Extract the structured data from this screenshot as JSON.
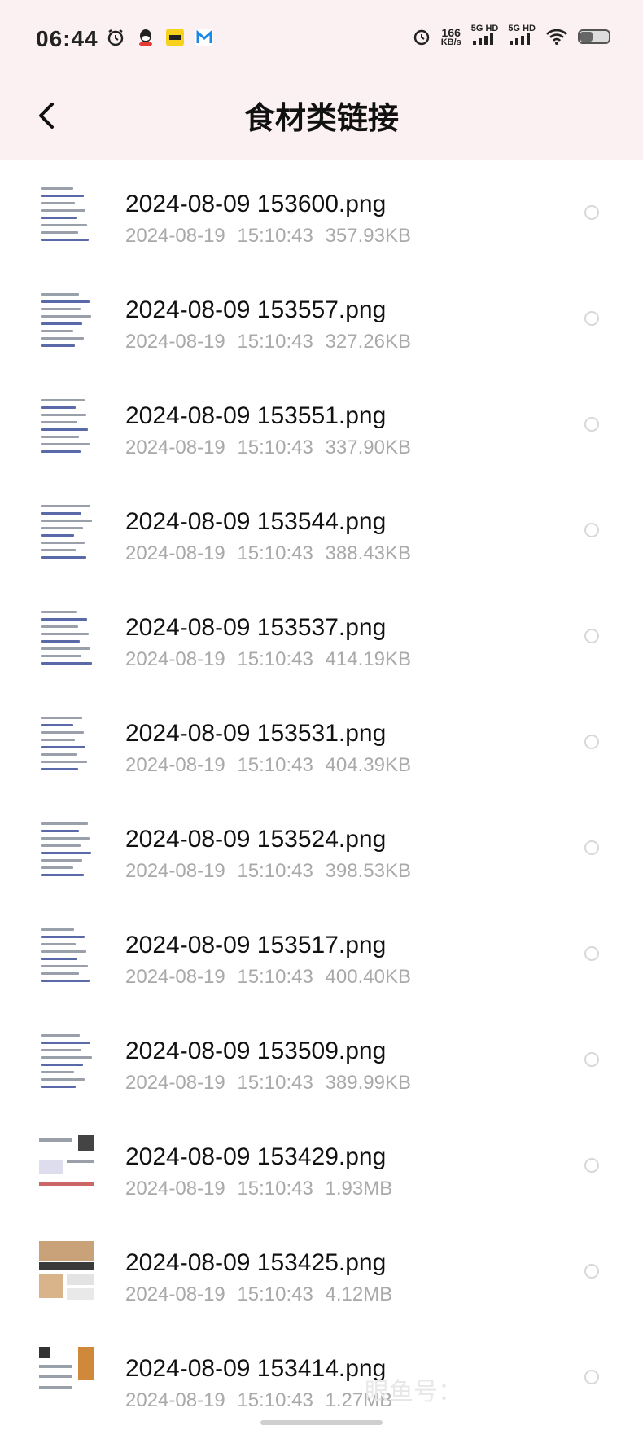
{
  "status_bar": {
    "time": "06:44",
    "net_speed_value": "166",
    "net_speed_unit": "KB/s",
    "sim1": "5G HD",
    "sim2": "5G HD",
    "battery_level": 0.45,
    "left_icons": [
      "alarm-icon",
      "qq-icon",
      "app-icon-yellow",
      "app-icon-blue"
    ],
    "right_icons": [
      "alarm-icon",
      "signal-icon",
      "signal-icon",
      "wifi-icon",
      "battery-icon"
    ]
  },
  "header": {
    "title": "食材类链接",
    "back_icon": "chevron-left-icon"
  },
  "files": [
    {
      "name": "2024-08-09 153600.png",
      "date": "2024-08-19",
      "time": "15:10:43",
      "size": "357.93KB"
    },
    {
      "name": "2024-08-09 153557.png",
      "date": "2024-08-19",
      "time": "15:10:43",
      "size": "327.26KB"
    },
    {
      "name": "2024-08-09 153551.png",
      "date": "2024-08-19",
      "time": "15:10:43",
      "size": "337.90KB"
    },
    {
      "name": "2024-08-09 153544.png",
      "date": "2024-08-19",
      "time": "15:10:43",
      "size": "388.43KB"
    },
    {
      "name": "2024-08-09 153537.png",
      "date": "2024-08-19",
      "time": "15:10:43",
      "size": "414.19KB"
    },
    {
      "name": "2024-08-09 153531.png",
      "date": "2024-08-19",
      "time": "15:10:43",
      "size": "404.39KB"
    },
    {
      "name": "2024-08-09 153524.png",
      "date": "2024-08-19",
      "time": "15:10:43",
      "size": "398.53KB"
    },
    {
      "name": "2024-08-09 153517.png",
      "date": "2024-08-19",
      "time": "15:10:43",
      "size": "400.40KB"
    },
    {
      "name": "2024-08-09 153509.png",
      "date": "2024-08-19",
      "time": "15:10:43",
      "size": "389.99KB"
    },
    {
      "name": "2024-08-09 153429.png",
      "date": "2024-08-19",
      "time": "15:10:43",
      "size": "1.93MB"
    },
    {
      "name": "2024-08-09 153425.png",
      "date": "2024-08-19",
      "time": "15:10:43",
      "size": "4.12MB"
    },
    {
      "name": "2024-08-09 153414.png",
      "date": "2024-08-19",
      "time": "15:10:43",
      "size": "1.27MB"
    }
  ],
  "overlay": {
    "watermark": "眼鱼号："
  }
}
